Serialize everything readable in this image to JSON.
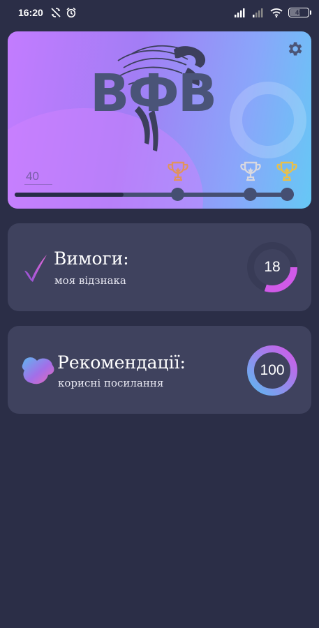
{
  "status_bar": {
    "time": "16:20",
    "left_icons": [
      "sync-off-icon",
      "alarm-icon"
    ],
    "right_icons": [
      "signal-icon",
      "signal-weak-icon",
      "wifi-icon"
    ],
    "battery": "49"
  },
  "hero": {
    "logo_text": "ВФВ",
    "score": "40",
    "progress_fraction": 0.39,
    "milestones": [
      {
        "name": "bronze",
        "color": "#e0935f"
      },
      {
        "name": "silver",
        "color": "#d8d8e0"
      },
      {
        "name": "gold",
        "color": "#e8c04a"
      }
    ],
    "colors": {
      "gradient_start": "#c37cff",
      "gradient_end": "#66c8f5"
    }
  },
  "cards": [
    {
      "title": "Вимоги:",
      "subtitle": "моя відзнака",
      "icon": "checkmark-icon",
      "ring_value": "18",
      "ring_fraction": 0.3
    },
    {
      "title": "Рекомендації:",
      "subtitle": "корисні посилання",
      "icon": "blob-icon",
      "ring_value": "100",
      "ring_fraction": 1.0
    }
  ]
}
